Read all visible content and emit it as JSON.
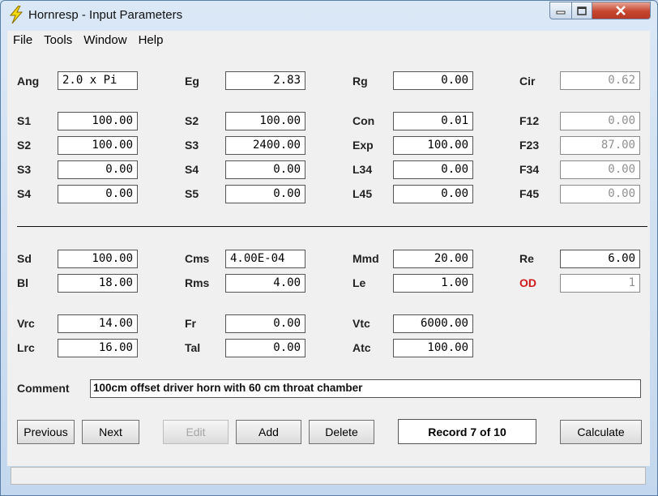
{
  "window": {
    "title": "Hornresp - Input Parameters"
  },
  "menu": {
    "items": [
      {
        "label": "File"
      },
      {
        "label": "Tools"
      },
      {
        "label": "Window"
      },
      {
        "label": "Help"
      }
    ]
  },
  "horn": {
    "ang": {
      "label": "Ang",
      "value": "2.0 x Pi"
    },
    "eg": {
      "label": "Eg",
      "value": "2.83"
    },
    "rg": {
      "label": "Rg",
      "value": "0.00"
    },
    "cir": {
      "label": "Cir",
      "value": "0.62"
    },
    "s1": {
      "label": "S1",
      "value": "100.00"
    },
    "s2a": {
      "label": "S2",
      "value": "100.00"
    },
    "s3a": {
      "label": "S3",
      "value": "0.00"
    },
    "s4a": {
      "label": "S4",
      "value": "0.00"
    },
    "s2b": {
      "label": "S2",
      "value": "100.00"
    },
    "s3b": {
      "label": "S3",
      "value": "2400.00"
    },
    "s4b": {
      "label": "S4",
      "value": "0.00"
    },
    "s5": {
      "label": "S5",
      "value": "0.00"
    },
    "con": {
      "label": "Con",
      "value": "0.01"
    },
    "exp": {
      "label": "Exp",
      "value": "100.00"
    },
    "l34": {
      "label": "L34",
      "value": "0.00"
    },
    "l45": {
      "label": "L45",
      "value": "0.00"
    },
    "f12": {
      "label": "F12",
      "value": "0.00"
    },
    "f23": {
      "label": "F23",
      "value": "87.00"
    },
    "f34": {
      "label": "F34",
      "value": "0.00"
    },
    "f45": {
      "label": "F45",
      "value": "0.00"
    }
  },
  "driver": {
    "sd": {
      "label": "Sd",
      "value": "100.00"
    },
    "bl": {
      "label": "Bl",
      "value": "18.00"
    },
    "vrc": {
      "label": "Vrc",
      "value": "14.00"
    },
    "lrc": {
      "label": "Lrc",
      "value": "16.00"
    },
    "cms": {
      "label": "Cms",
      "value": "4.00E-04"
    },
    "rms": {
      "label": "Rms",
      "value": "4.00"
    },
    "fr": {
      "label": "Fr",
      "value": "0.00"
    },
    "tal": {
      "label": "Tal",
      "value": "0.00"
    },
    "mmd": {
      "label": "Mmd",
      "value": "20.00"
    },
    "le": {
      "label": "Le",
      "value": "1.00"
    },
    "vtc": {
      "label": "Vtc",
      "value": "6000.00"
    },
    "atc": {
      "label": "Atc",
      "value": "100.00"
    },
    "re": {
      "label": "Re",
      "value": "6.00"
    },
    "od": {
      "label": "OD",
      "value": "1"
    }
  },
  "comment": {
    "label": "Comment",
    "value": "100cm offset driver horn with 60 cm throat chamber"
  },
  "buttons": {
    "previous": "Previous",
    "next": "Next",
    "edit": "Edit",
    "add": "Add",
    "delete": "Delete",
    "calculate": "Calculate"
  },
  "record": "Record 7 of 10",
  "status": "",
  "colors": {
    "od_label": "#d01a1a",
    "readonly_text": "#909090"
  }
}
